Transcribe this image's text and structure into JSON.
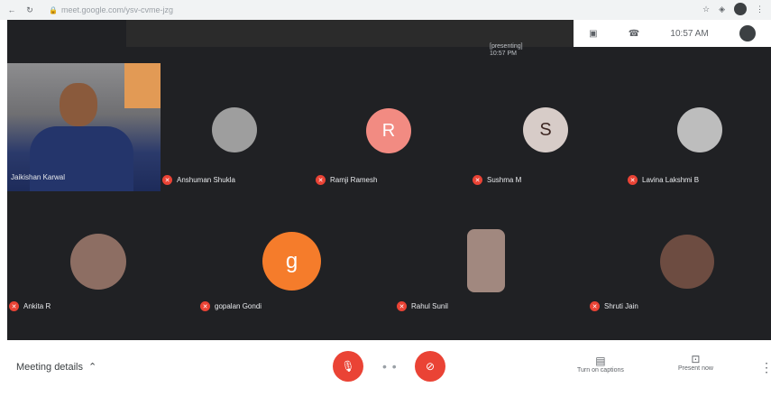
{
  "browser": {
    "back_icon": "arrow-left-icon",
    "url_text": "meet.google.com/ysv-cvme-jzg",
    "icons": [
      "star-icon",
      "extension-icon"
    ]
  },
  "overlay": {
    "presenting_line1": "[presenting]",
    "presenting_line2": "10:57 PM",
    "clock": "10:57 AM",
    "status_icons": [
      "caption-icon",
      "phone-icon"
    ]
  },
  "participants": [
    {
      "name": "Jaikishan Karwal",
      "type": "video"
    },
    {
      "name": "Anshuman Shukla",
      "type": "photo",
      "color": "#9e9e9e"
    },
    {
      "name": "Ramji Ramesh",
      "type": "letter",
      "letter": "R",
      "color": "#f28b82"
    },
    {
      "name": "Sushma M",
      "type": "photo",
      "color": "#d7ccc8"
    },
    {
      "name": "Lavina Lakshmi B",
      "type": "photo",
      "color": "#bdbdbd"
    },
    {
      "name": "Ankita R",
      "type": "photo",
      "color": "#8d6e63"
    },
    {
      "name": "gopalan Gondi",
      "type": "letter",
      "letter": "g",
      "color": "#f57c2b"
    },
    {
      "name": "Rahul Sunil",
      "type": "photo",
      "color": "#a1887f"
    },
    {
      "name": "Shruti Jain",
      "type": "photo",
      "color": "#6d4c41"
    }
  ],
  "controls": {
    "meeting_details": "Meeting details",
    "mic_icon": "mic-off-icon",
    "cam_icon": "camera-off-icon",
    "turn_on_captions": "Turn on captions",
    "present_now": "Present now"
  },
  "colors": {
    "meeting_bg": "#202124",
    "accent_red": "#ea4335"
  }
}
